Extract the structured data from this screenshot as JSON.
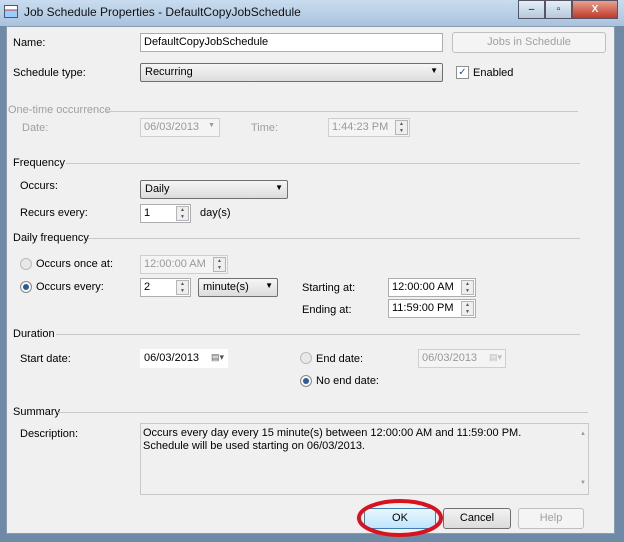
{
  "window": {
    "title": "Job Schedule Properties - DefaultCopyJobSchedule",
    "minimize": "–",
    "maximize": "▫",
    "close": "X"
  },
  "form": {
    "name_label": "Name:",
    "name_value": "DefaultCopyJobSchedule",
    "jobs_button": "Jobs in Schedule",
    "schedule_type_label": "Schedule type:",
    "schedule_type_value": "Recurring",
    "enabled_label": "Enabled",
    "enabled_checked": true,
    "one_time": {
      "header": "One-time occurrence",
      "date_label": "Date:",
      "date_value": "06/03/2013",
      "time_label": "Time:",
      "time_value": "1:44:23 PM"
    },
    "frequency": {
      "header": "Frequency",
      "occurs_label": "Occurs:",
      "occurs_value": "Daily",
      "recurs_label": "Recurs every:",
      "recurs_value": "1",
      "recurs_unit": "day(s)"
    },
    "daily": {
      "header": "Daily frequency",
      "once_label": "Occurs once at:",
      "once_value": "12:00:00 AM",
      "every_label": "Occurs every:",
      "every_value": "2",
      "every_unit": "minute(s)",
      "start_label": "Starting at:",
      "start_value": "12:00:00 AM",
      "end_label": "Ending at:",
      "end_value": "11:59:00 PM",
      "selected": "Occurs every"
    },
    "duration": {
      "header": "Duration",
      "start_label": "Start date:",
      "start_value": "06/03/2013",
      "end_label": "End date:",
      "end_value": "06/03/2013",
      "no_end_label": "No end date:",
      "selected": "No end date"
    },
    "summary": {
      "header": "Summary",
      "desc_label": "Description:",
      "desc_value": "Occurs every day every 15 minute(s) between 12:00:00 AM and 11:59:00 PM. Schedule will be used starting on 06/03/2013."
    }
  },
  "buttons": {
    "ok": "OK",
    "cancel": "Cancel",
    "help": "Help"
  },
  "annotation_color": "#d9121f"
}
